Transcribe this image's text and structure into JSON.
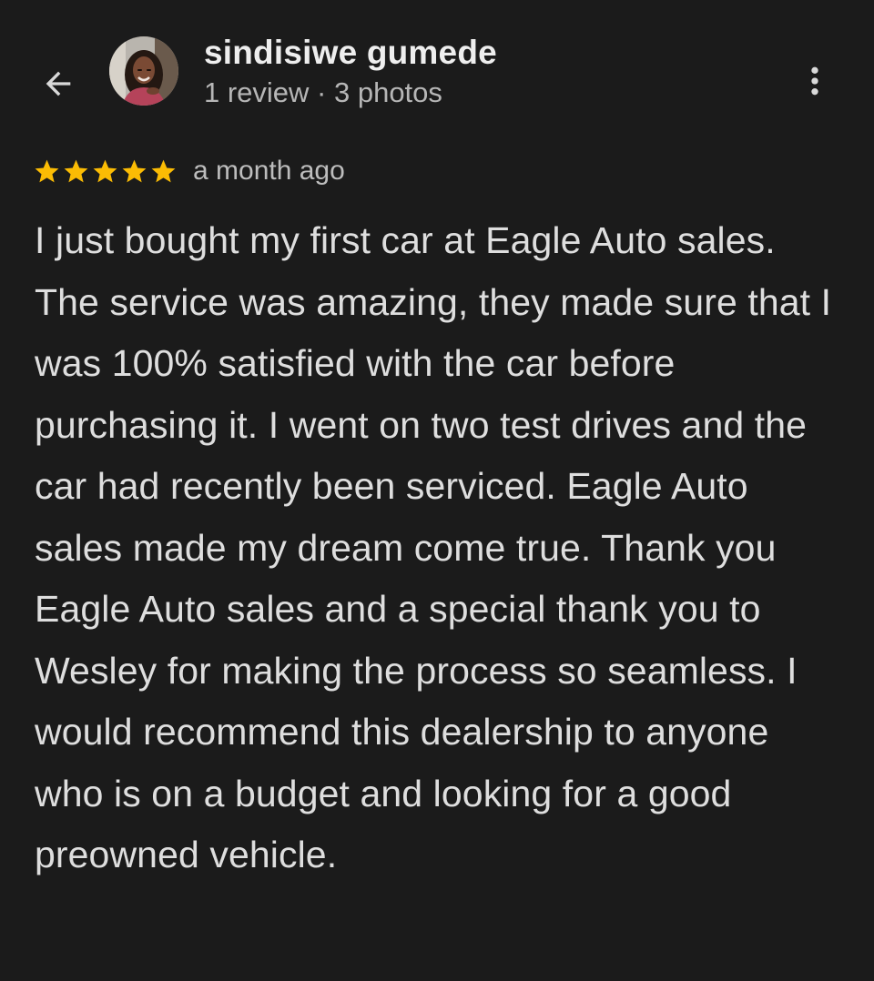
{
  "header": {
    "back_icon": "arrow-back-icon",
    "avatar_alt": "reviewer profile photo",
    "reviewer_name": "sindisiwe gumede",
    "reviewer_meta": "1 review · 3 photos",
    "more_icon": "more-vertical-icon"
  },
  "review": {
    "rating": 5,
    "max_rating": 5,
    "star_color": "#fbbc04",
    "date": "a month ago",
    "text": "I just bought my first car at Eagle Auto sales. The service was amazing, they made sure that I was 100% satisfied with the car before purchasing it. I went on two test drives and the car had recently been serviced. Eagle Auto sales made my dream come true. Thank you Eagle Auto sales and a special thank you to Wesley for making the process so seamless. I would recommend this dealership to anyone who is on a budget and looking for a good preowned vehicle."
  },
  "theme": {
    "background": "#1b1b1b",
    "text_primary": "#eeeeee",
    "text_secondary": "#b6b6b6"
  }
}
